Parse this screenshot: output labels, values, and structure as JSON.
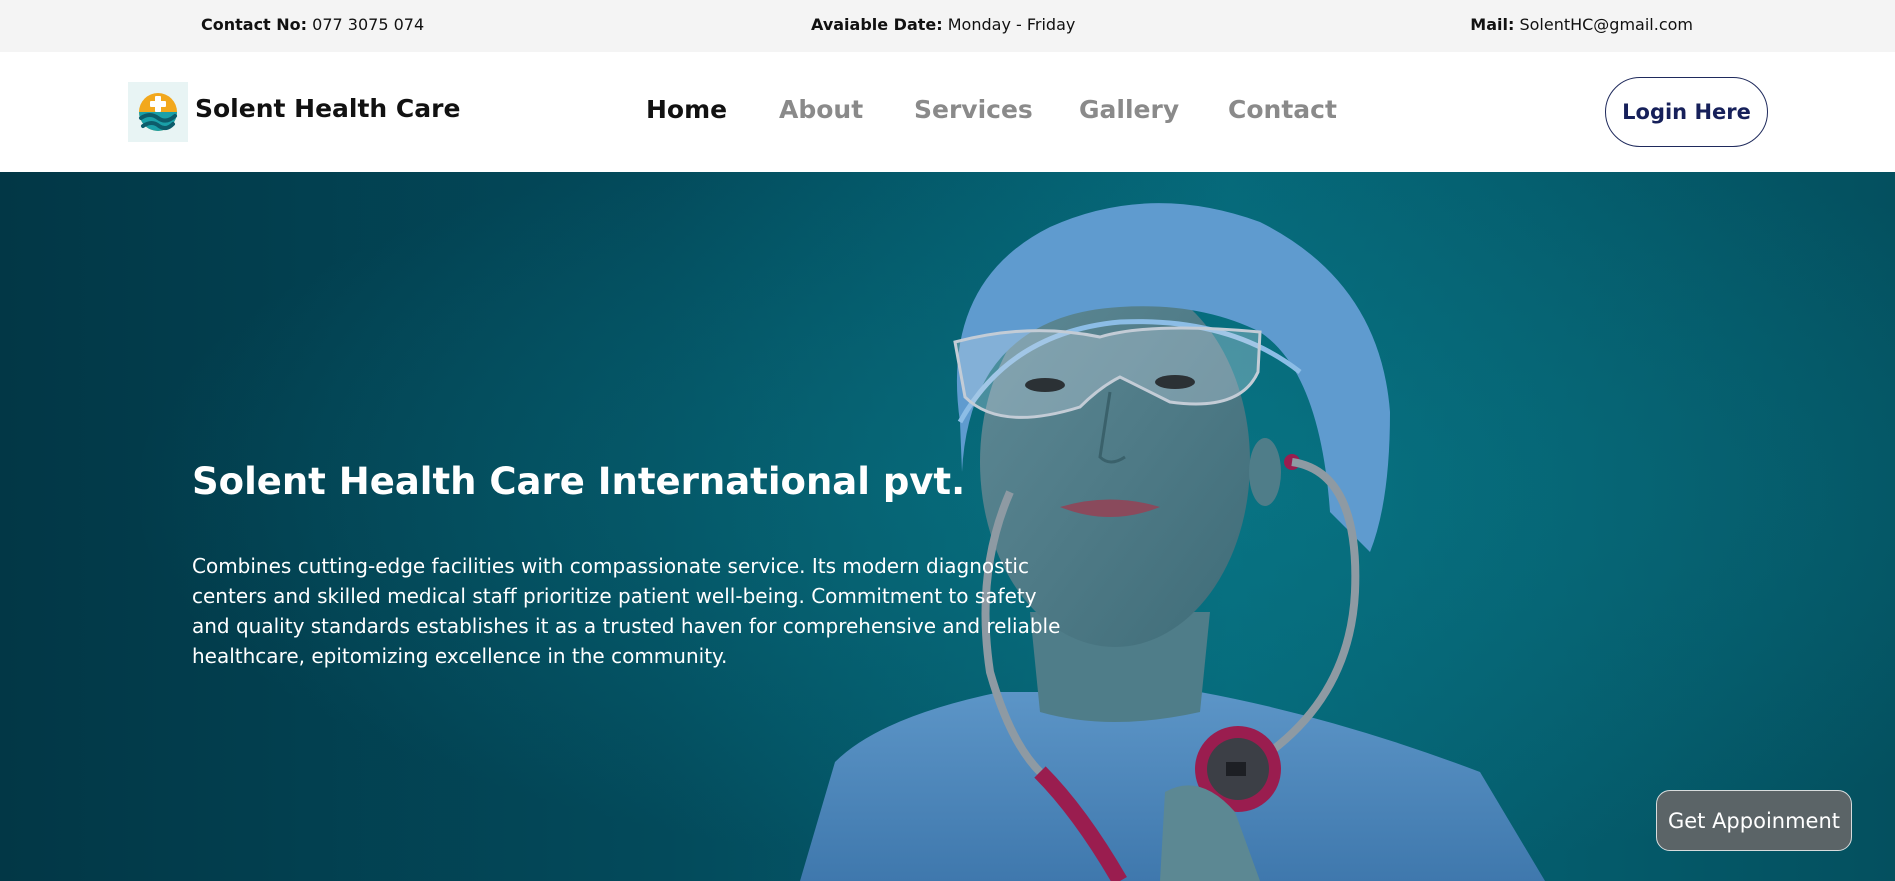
{
  "topbar": {
    "contact_label": "Contact No:",
    "contact_value": "077 3075 074",
    "date_label": "Avaiable Date:",
    "date_value": "Monday - Friday",
    "mail_label": "Mail:",
    "mail_value": "SolentHC@gmail.com"
  },
  "navbar": {
    "brand": "Solent Health Care",
    "links": [
      {
        "label": "Home"
      },
      {
        "label": "About"
      },
      {
        "label": "Services"
      },
      {
        "label": "Gallery"
      },
      {
        "label": "Contact"
      }
    ],
    "active": "Home",
    "login_label": "Login Here"
  },
  "hero": {
    "title": "Solent Health Care International pvt.",
    "description": "Combines cutting-edge facilities with compassionate service. Its modern diagnostic centers and skilled medical staff prioritize patient well-being. Commitment to safety and quality standards establishes it as a trusted haven for comprehensive and reliable healthcare, epitomizing excellence in the community.",
    "appointment_label": "Get Appoinment",
    "image_subject": "doctor with surgical cap, safety glasses and stethoscope"
  },
  "colors": {
    "hero_bg": "#034a5b",
    "nav_inactive": "#8a8a8a",
    "nav_active": "#111111",
    "login_text": "#16205a",
    "scrub_blue": "#5b8fc6",
    "stethoscope": "#9a1d4f"
  }
}
